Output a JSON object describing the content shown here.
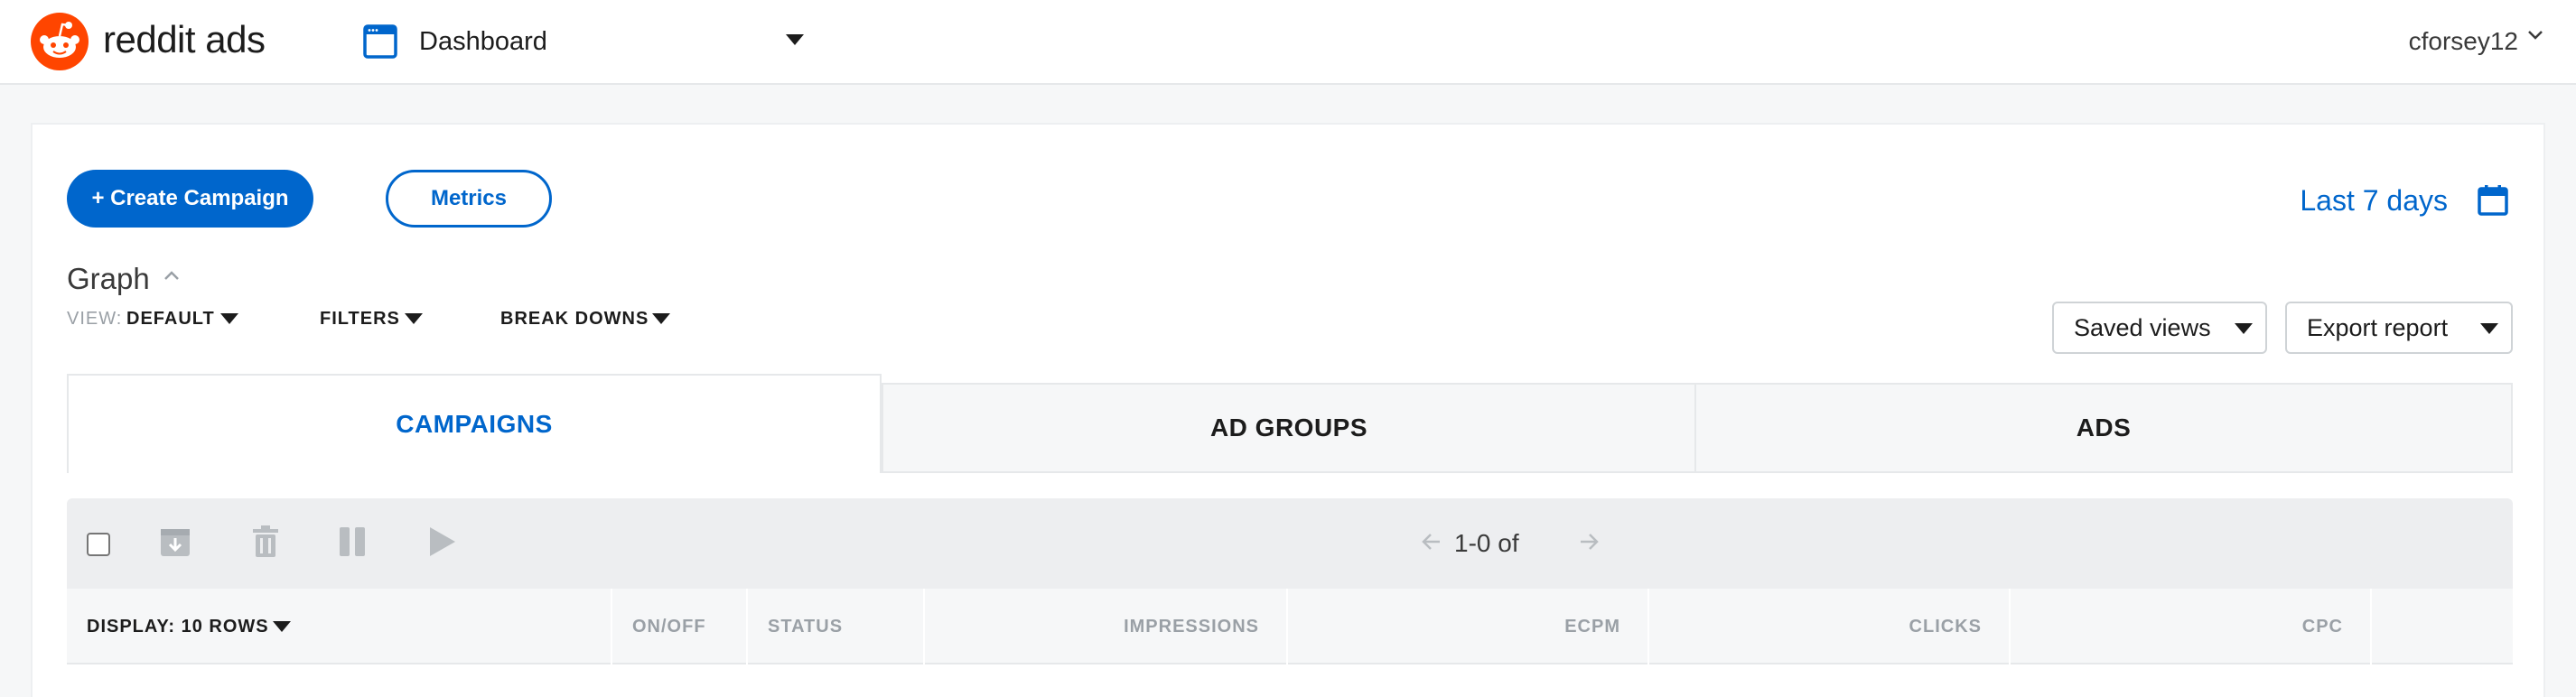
{
  "header": {
    "brand": "reddit ads",
    "section": "Dashboard",
    "username": "cforsey12"
  },
  "actions": {
    "create_campaign": "+ Create Campaign",
    "metrics": "Metrics",
    "date_range": "Last 7 days"
  },
  "graph": {
    "title": "Graph",
    "view_key": "VIEW:",
    "view_value": "DEFAULT",
    "filters": "FILTERS",
    "breakdowns": "BREAK DOWNS"
  },
  "controls": {
    "saved_views": "Saved views",
    "export_report": "Export report"
  },
  "tabs": [
    {
      "label": "CAMPAIGNS",
      "active": true
    },
    {
      "label": "AD GROUPS",
      "active": false
    },
    {
      "label": "ADS",
      "active": false
    }
  ],
  "pager": {
    "text": "1-0 of"
  },
  "table": {
    "columns": [
      "DISPLAY: 10 ROWS",
      "ON/OFF",
      "STATUS",
      "IMPRESSIONS",
      "ECPM",
      "CLICKS",
      "CPC"
    ]
  },
  "colors": {
    "accent": "#0066cc",
    "brand": "#ff4500"
  }
}
